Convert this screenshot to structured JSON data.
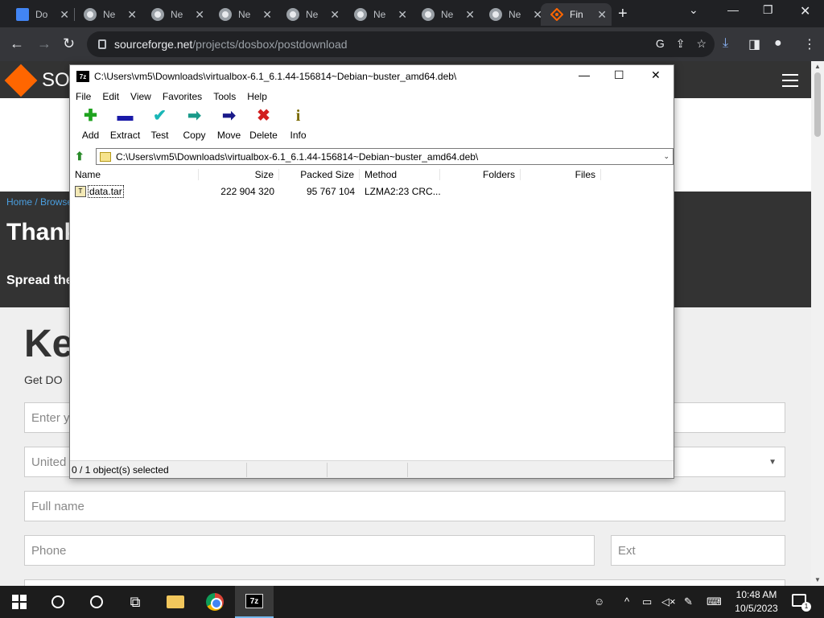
{
  "browser": {
    "tabs": [
      {
        "title": "Do",
        "icon": "docs-icon"
      },
      {
        "title": "Ne",
        "icon": "chrome-icon"
      },
      {
        "title": "Ne",
        "icon": "chrome-icon"
      },
      {
        "title": "Ne",
        "icon": "chrome-icon"
      },
      {
        "title": "Ne",
        "icon": "chrome-icon"
      },
      {
        "title": "Ne",
        "icon": "chrome-icon"
      },
      {
        "title": "Ne",
        "icon": "chrome-icon"
      },
      {
        "title": "Ne",
        "icon": "chrome-icon"
      },
      {
        "title": "Fin",
        "icon": "sourceforge-icon",
        "active": true
      }
    ],
    "url_host": "sourceforge.net",
    "url_path": "/projects/dosbox/postdownload"
  },
  "webpage": {
    "logo_text": "SO",
    "breadcrumb": "Home / Browse",
    "heading": "Thank",
    "spread": "Spread the",
    "ke_heading": "Ke",
    "get_do": "Get DO",
    "email_placeholder": "Enter y",
    "country_value": "United",
    "fullname_placeholder": "Full name",
    "phone_placeholder": "Phone",
    "ext_placeholder": "Ext"
  },
  "sevenzip": {
    "title": "C:\\Users\\vm5\\Downloads\\virtualbox-6.1_6.1.44-156814~Debian~buster_amd64.deb\\",
    "app_icon_text": "7z",
    "menu": [
      "File",
      "Edit",
      "View",
      "Favorites",
      "Tools",
      "Help"
    ],
    "toolbar": [
      {
        "label": "Add",
        "icon": "plus-icon",
        "glyph": "✚",
        "color": "#1fa31f"
      },
      {
        "label": "Extract",
        "icon": "minus-icon",
        "glyph": "▬",
        "color": "#1a1aa8"
      },
      {
        "label": "Test",
        "icon": "check-icon",
        "glyph": "✔",
        "color": "#19b6b6"
      },
      {
        "label": "Copy",
        "icon": "copy-arrow-icon",
        "glyph": "➡",
        "color": "#1a9a8a"
      },
      {
        "label": "Move",
        "icon": "move-arrow-icon",
        "glyph": "➡",
        "color": "#1a1a8a"
      },
      {
        "label": "Delete",
        "icon": "delete-x-icon",
        "glyph": "✖",
        "color": "#d21f1f"
      },
      {
        "label": "Info",
        "icon": "info-icon",
        "glyph": "i",
        "color": "#7a6a00"
      }
    ],
    "address": "C:\\Users\\vm5\\Downloads\\virtualbox-6.1_6.1.44-156814~Debian~buster_amd64.deb\\",
    "columns": {
      "name": "Name",
      "size": "Size",
      "packed": "Packed Size",
      "method": "Method",
      "folders": "Folders",
      "files": "Files"
    },
    "rows": [
      {
        "name": "data.tar",
        "size": "222 904 320",
        "packed": "95 767 104",
        "method": "LZMA2:23 CRC...",
        "folders": "",
        "files": ""
      }
    ],
    "status": "0 / 1 object(s) selected"
  },
  "taskbar": {
    "time": "10:48 AM",
    "date": "10/5/2023",
    "notification_count": "1"
  }
}
